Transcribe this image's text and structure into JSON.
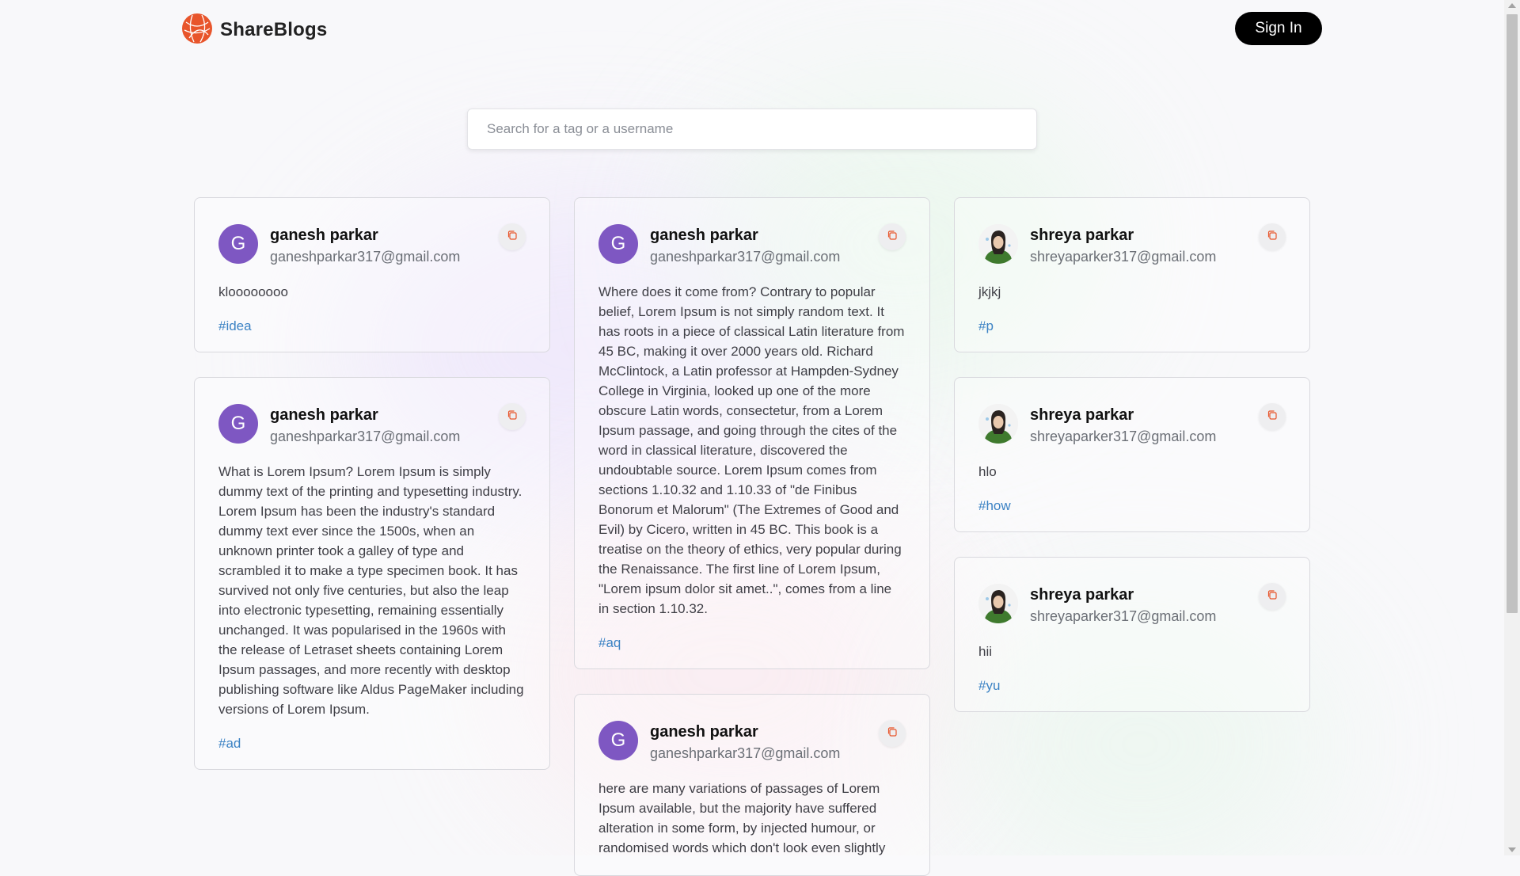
{
  "brand": {
    "name": "ShareBlogs",
    "logo_icon": "globe-logo-icon",
    "logo_color": "#e8552b"
  },
  "nav": {
    "signin_label": "Sign In"
  },
  "search": {
    "placeholder": "Search for a tag or a username",
    "value": ""
  },
  "columns": [
    [
      {
        "name": "ganesh parkar",
        "email": "ganeshparkar317@gmail.com",
        "avatar": "G",
        "avatar_type": "letter",
        "body": "kloooooooo",
        "tag": "#idea"
      },
      {
        "name": "ganesh parkar",
        "email": "ganeshparkar317@gmail.com",
        "avatar": "G",
        "avatar_type": "letter",
        "body": "What is Lorem Ipsum? Lorem Ipsum is simply dummy text of the printing and typesetting industry. Lorem Ipsum has been the industry's standard dummy text ever since the 1500s, when an unknown printer took a galley of type and scrambled it to make a type specimen book. It has survived not only five centuries, but also the leap into electronic typesetting, remaining essentially unchanged. It was popularised in the 1960s with the release of Letraset sheets containing Lorem Ipsum passages, and more recently with desktop publishing software like Aldus PageMaker including versions of Lorem Ipsum.",
        "tag": "#ad"
      }
    ],
    [
      {
        "name": "ganesh parkar",
        "email": "ganeshparkar317@gmail.com",
        "avatar": "G",
        "avatar_type": "letter",
        "body": "Where does it come from? Contrary to popular belief, Lorem Ipsum is not simply random text. It has roots in a piece of classical Latin literature from 45 BC, making it over 2000 years old. Richard McClintock, a Latin professor at Hampden-Sydney College in Virginia, looked up one of the more obscure Latin words, consectetur, from a Lorem Ipsum passage, and going through the cites of the word in classical literature, discovered the undoubtable source. Lorem Ipsum comes from sections 1.10.32 and 1.10.33 of \"de Finibus Bonorum et Malorum\" (The Extremes of Good and Evil) by Cicero, written in 45 BC. This book is a treatise on the theory of ethics, very popular during the Renaissance. The first line of Lorem Ipsum, \"Lorem ipsum dolor sit amet..\", comes from a line in section 1.10.32.",
        "tag": "#aq"
      },
      {
        "name": "ganesh parkar",
        "email": "ganeshparkar317@gmail.com",
        "avatar": "G",
        "avatar_type": "letter",
        "body": "here are many variations of passages of Lorem Ipsum available, but the majority have suffered alteration in some form, by injected humour, or randomised words which don't look even slightly",
        "tag": ""
      }
    ],
    [
      {
        "name": "shreya parkar",
        "email": "shreyaparker317@gmail.com",
        "avatar": "",
        "avatar_type": "photo",
        "body": "jkjkj",
        "tag": "#p"
      },
      {
        "name": "shreya parkar",
        "email": "shreyaparker317@gmail.com",
        "avatar": "",
        "avatar_type": "photo",
        "body": "hlo",
        "tag": "#how"
      },
      {
        "name": "shreya parkar",
        "email": "shreyaparker317@gmail.com",
        "avatar": "",
        "avatar_type": "photo",
        "body": "hii",
        "tag": "#yu"
      }
    ]
  ],
  "colors": {
    "avatar_bg": "#7e57c2",
    "tag": "#3b82c4",
    "copy_icon": "#e8552b"
  }
}
